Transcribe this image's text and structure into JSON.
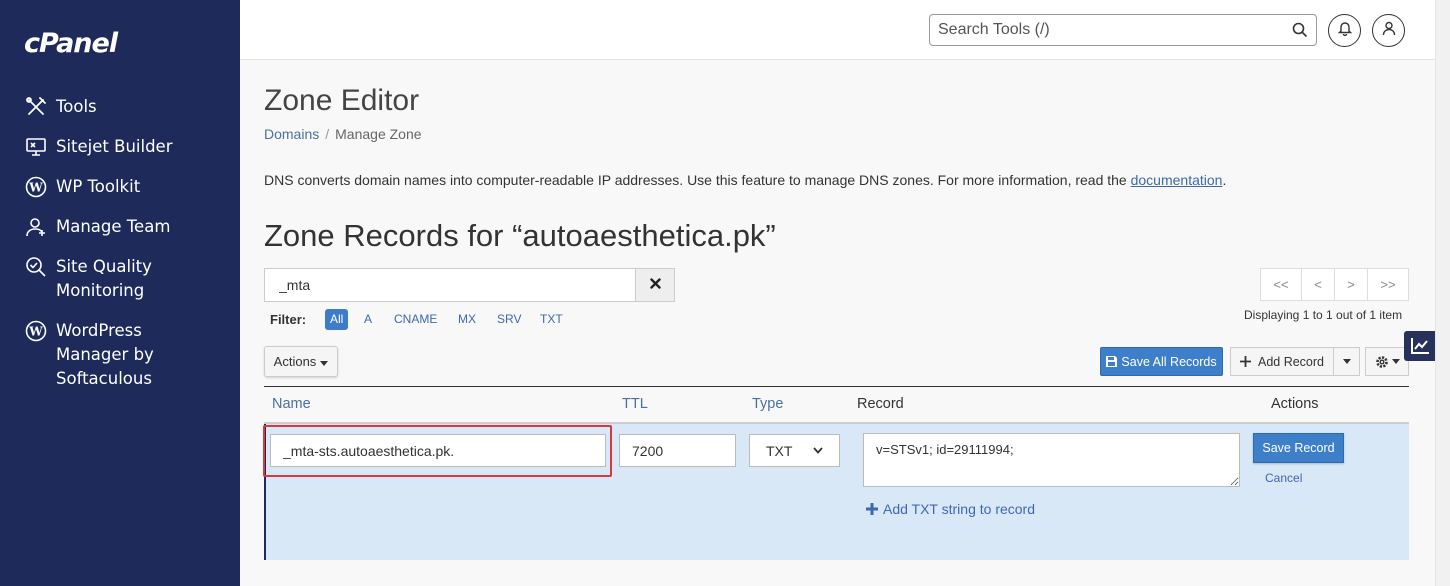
{
  "app": {
    "logo": "cPanel"
  },
  "sidebar": {
    "items": [
      {
        "label": "Tools",
        "icon": "tools-icon"
      },
      {
        "label": "Sitejet Builder",
        "icon": "sitejet-builder-icon"
      },
      {
        "label": "WP Toolkit",
        "icon": "wordpress-icon"
      },
      {
        "label": "Manage Team",
        "icon": "manage-team-icon"
      },
      {
        "label": "Site Quality Monitoring",
        "icon": "site-quality-icon"
      },
      {
        "label": "WordPress Manager by Softaculous",
        "icon": "wordpress-icon"
      }
    ]
  },
  "topbar": {
    "search_placeholder": "Search Tools (/)",
    "notifications_icon": "bell-icon",
    "user_icon": "user-icon"
  },
  "page": {
    "title": "Zone Editor",
    "breadcrumb": {
      "parent": "Domains",
      "current": "Manage Zone"
    },
    "intro_text": "DNS converts domain names into computer-readable IP addresses. Use this feature to manage DNS zones. For more information, read the",
    "intro_link": "documentation",
    "intro_end": "."
  },
  "zone": {
    "title": "Zone Records for “autoaesthetica.pk”",
    "filter_value": "_mta",
    "filter_label": "Filter:",
    "filters": [
      "All",
      "A",
      "CNAME",
      "MX",
      "SRV",
      "TXT"
    ],
    "active_filter": "All",
    "pagination": {
      "first": "<<",
      "prev": "<",
      "next": ">",
      "last": ">>",
      "info": "Displaying 1 to 1 out of 1 item"
    },
    "actions_label": "Actions",
    "save_all_label": "Save All Records",
    "add_record_label": "Add Record"
  },
  "table": {
    "columns": {
      "name": "Name",
      "ttl": "TTL",
      "type": "Type",
      "record": "Record",
      "actions": "Actions"
    },
    "row": {
      "name": "_mta-sts.autoaesthetica.pk.",
      "ttl": "7200",
      "type": "TXT",
      "record": "v=STSv1; id=29111994;",
      "add_txt_label": "Add TXT string to record",
      "save_label": "Save Record",
      "cancel_label": "Cancel"
    }
  },
  "colors": {
    "sidebar_bg": "#1d2a5a",
    "primary": "#3d80c9",
    "row_bg": "#d9e8f6",
    "highlight": "#d9373a"
  }
}
